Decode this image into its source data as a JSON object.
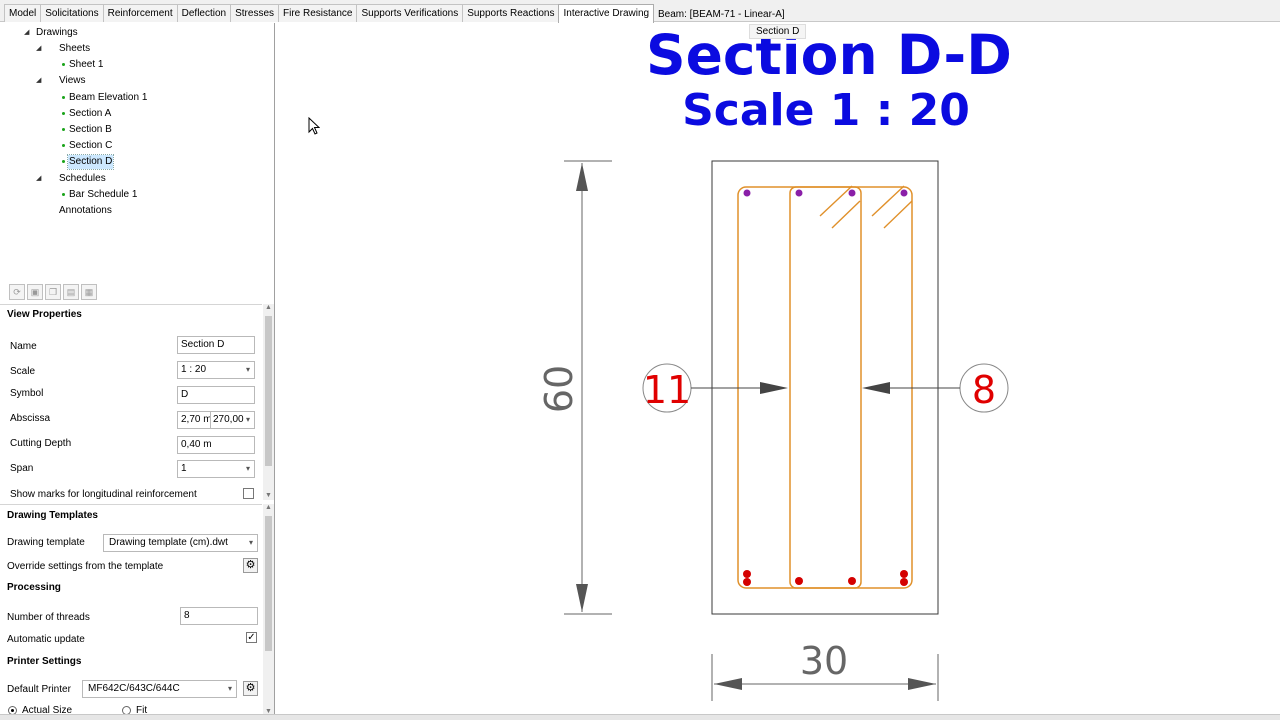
{
  "tabs": [
    {
      "label": "Model"
    },
    {
      "label": "Solicitations"
    },
    {
      "label": "Reinforcement"
    },
    {
      "label": "Deflection"
    },
    {
      "label": "Stresses"
    },
    {
      "label": "Fire Resistance"
    },
    {
      "label": "Supports Verifications"
    },
    {
      "label": "Supports Reactions"
    },
    {
      "label": "Interactive Drawing"
    }
  ],
  "active_tab": "Interactive Drawing",
  "beam_title": "Beam: [BEAM-71 - Linear-A]",
  "tree": {
    "root": "Drawings",
    "sheets": "Sheets",
    "sheet_1": "Sheet 1",
    "views": "Views",
    "beam_elevation": "Beam Elevation 1",
    "section_a": "Section A",
    "section_b": "Section B",
    "section_c": "Section C",
    "section_d": "Section D",
    "schedules": "Schedules",
    "bar_schedule": "Bar Schedule 1",
    "annotations": "Annotations"
  },
  "view_properties": {
    "header": "View Properties",
    "name_label": "Name",
    "name_value": "Section D",
    "scale_label": "Scale",
    "scale_value": "1 : 20",
    "symbol_label": "Symbol",
    "symbol_value": "D",
    "abscissa_label": "Abscissa",
    "abscissa_value": "2,70 m",
    "abscissa_combo": "270,00",
    "cutting_depth_label": "Cutting Depth",
    "cutting_depth_value": "0,40 m",
    "span_label": "Span",
    "span_value": "1",
    "show_marks_label": "Show marks for longitudinal reinforcement",
    "show_marks_checked": false
  },
  "drawing_templates": {
    "header": "Drawing Templates",
    "template_label": "Drawing template",
    "template_value": "Drawing template (cm).dwt",
    "override_label": "Override settings from the template"
  },
  "processing": {
    "header": "Processing",
    "threads_label": "Number of threads",
    "threads_value": "8",
    "auto_update_label": "Automatic update",
    "auto_update_checked": true
  },
  "printer_settings": {
    "header": "Printer Settings",
    "default_printer_label": "Default Printer",
    "default_printer_value": "MF642C/643C/644C",
    "actual_size_label": "Actual Size",
    "fit_label": "Fit"
  },
  "drawing": {
    "tooltip": "Section D",
    "title": "Section D-D",
    "scale_title": "Scale 1 : 20",
    "height_dim": "60",
    "width_dim": "30",
    "mark_left": "11",
    "mark_right": "8",
    "colors": {
      "title": "#0b0be0",
      "stirrup": "#e0902a",
      "bar_bottom": "#d40000",
      "bar_top": "#8a1fa8",
      "mark_text": "#e00000",
      "dimension": "#666666"
    }
  },
  "icons": [
    "expand-icon",
    "leaf-dot-icon",
    "gear-icon",
    "dropdown-arrow-icon",
    "arrow-cursor-icon"
  ]
}
